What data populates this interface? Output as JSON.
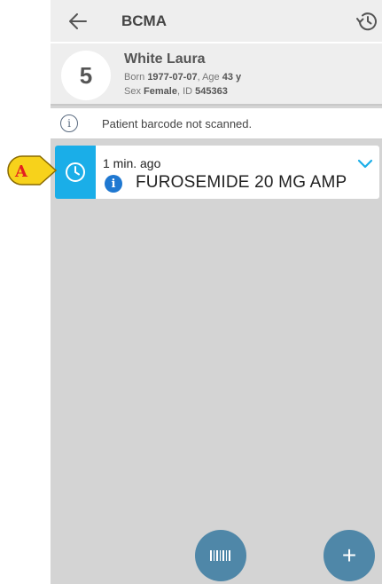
{
  "header": {
    "title": "BCMA",
    "back_icon": "arrow-left-icon",
    "history_icon": "history-icon"
  },
  "patient": {
    "bed": "5",
    "name": "White Laura",
    "born_label": "Born",
    "born_value": "1977-07-07",
    "age_label": ", Age",
    "age_value": "43 y",
    "sex_label": "Sex",
    "sex_value": "Female",
    "id_label": ", ID",
    "id_value": "545363"
  },
  "notice": {
    "text": "Patient barcode not scanned.",
    "icon": "info-outline-icon"
  },
  "administrations": [
    {
      "time": "1 min. ago",
      "drug": "FUROSEMIDE 20 MG AMP",
      "status_icon": "clock-icon",
      "status_color": "#1aaee8",
      "info_icon": "info-icon"
    }
  ],
  "callout": {
    "label": "A",
    "color": "#f7d21b"
  },
  "actions": {
    "scan_icon": "barcode-icon",
    "add_icon": "plus-icon",
    "add_label": "+"
  },
  "colors": {
    "accent": "#1aaee8",
    "fab": "#4f87a8",
    "background": "#d4d4d4"
  }
}
